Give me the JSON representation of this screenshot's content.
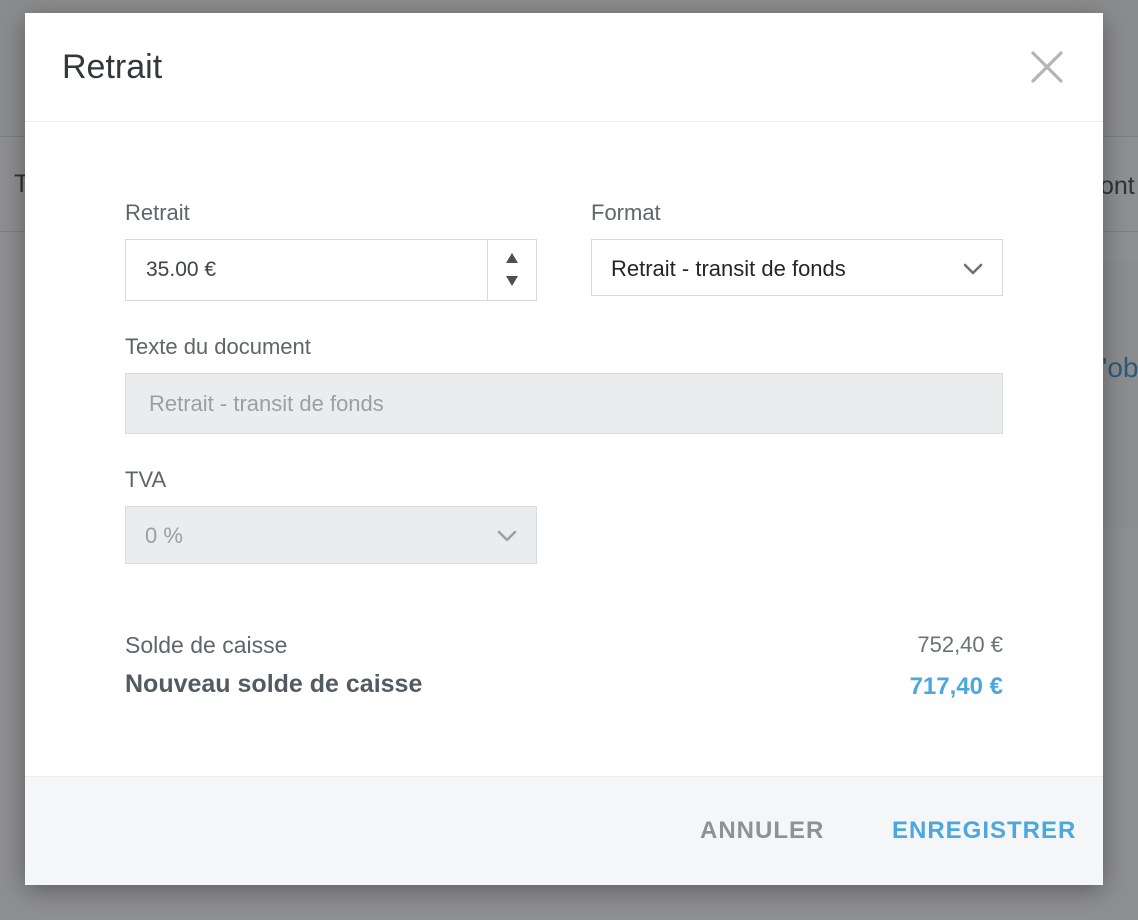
{
  "background": {
    "left_text": "T",
    "right_text": "ont",
    "link_text": "'ob"
  },
  "modal": {
    "title": "Retrait",
    "close_icon": "close-icon",
    "amount": {
      "label": "Retrait",
      "value": "35.00 €"
    },
    "format": {
      "label": "Format",
      "selected": "Retrait - transit de fonds"
    },
    "document_text": {
      "label": "Texte du document",
      "placeholder": "Retrait - transit de fonds"
    },
    "vat": {
      "label": "TVA",
      "selected": "0 %"
    },
    "summary": {
      "balance_label": "Solde de caisse",
      "balance_value": "752,40 €",
      "new_balance_label": "Nouveau solde de caisse",
      "new_balance_value": "717,40 €"
    },
    "footer": {
      "cancel_label": "ANNULER",
      "save_label": "ENREGISTRER"
    }
  },
  "colors": {
    "accent": "#4ca8dc",
    "cancel": "#8d9298",
    "overlay": "#8e8f91"
  }
}
